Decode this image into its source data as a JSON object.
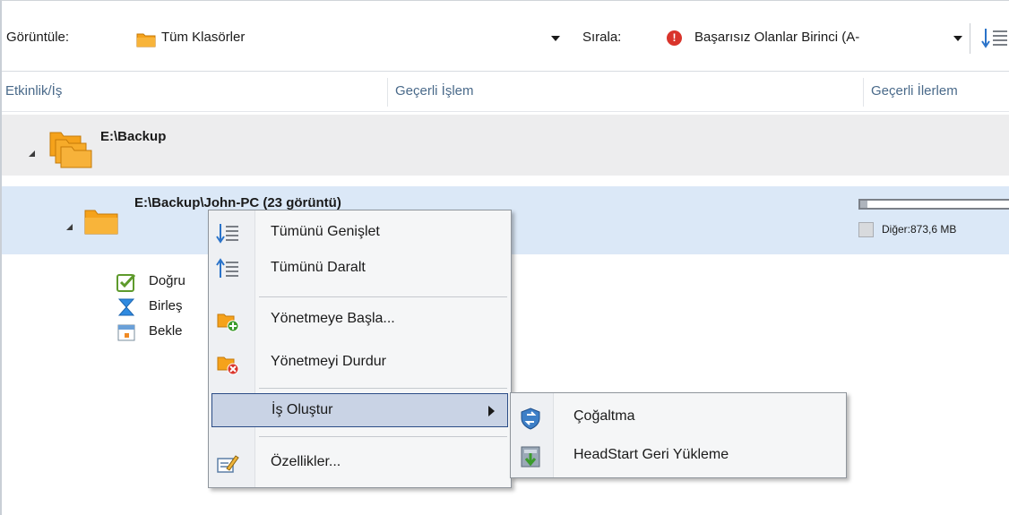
{
  "toolbar": {
    "view_label": "Görüntüle:",
    "view_value": "Tüm Klasörler",
    "sort_label": "Sırala:",
    "sort_value": "Başarısız Olanlar Birinci (A-",
    "error_icon_glyph": "!"
  },
  "columns": [
    "Etkinlik/İş",
    "Geçerli İşlem",
    "Geçerli İlerlem"
  ],
  "group": {
    "label": "E:\\Backup"
  },
  "subgroup": {
    "label": "E:\\Backup\\John-PC  (23 görüntü)",
    "progress_fraction": 0.05,
    "legend": "Diğer:873,6 MB"
  },
  "jobs": [
    {
      "label": "Doğru",
      "icon": "check-icon"
    },
    {
      "label": "Birleş",
      "icon": "hourglass-icon"
    },
    {
      "label": "Bekle",
      "icon": "calendar-icon"
    }
  ],
  "context_menu": {
    "items": [
      {
        "label": "Tümünü Genişlet",
        "icon": "expand-all-icon"
      },
      {
        "label": "Tümünü Daralt",
        "icon": "collapse-all-icon"
      },
      {
        "label": "Yönetmeye Başla...",
        "icon": "start-manage-icon"
      },
      {
        "label": "Yönetmeyi Durdur",
        "icon": "stop-manage-icon"
      },
      {
        "label": "İş Oluştur",
        "icon": "create-job-icon",
        "highlighted": true,
        "has_submenu": true
      },
      {
        "label": "Özellikler...",
        "icon": "properties-icon"
      }
    ]
  },
  "submenu": {
    "items": [
      {
        "label": "Çoğaltma",
        "icon": "replication-icon"
      },
      {
        "label": "HeadStart Geri Yükleme",
        "icon": "headstart-restore-icon"
      }
    ]
  },
  "colors": {
    "folder": "#f5a21b",
    "selection": "#dbe8f7",
    "menu_highlight": "#c9d3e5",
    "header_text": "#4a6a8a"
  }
}
